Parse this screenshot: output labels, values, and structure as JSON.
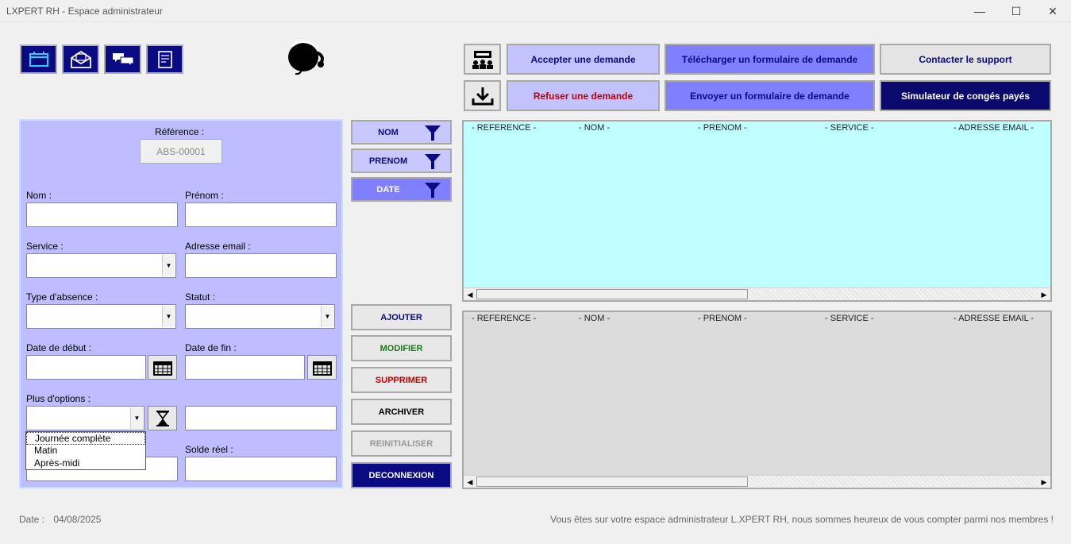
{
  "window": {
    "title": "LXPERT RH - Espace administrateur",
    "minimize": "—",
    "maximize": "☐",
    "close": "✕"
  },
  "top_icons": [
    "calendar-icon",
    "mail-icon",
    "chat-icon",
    "document-icon"
  ],
  "actions": {
    "accept": "Accepter une demande",
    "refuse": "Refuser une demande",
    "download_form": "Télécharger un formulaire de demande",
    "send_form": "Envoyer un formulaire de demande",
    "contact": "Contacter le support",
    "simulator": "Simulateur de congés payés"
  },
  "colors": {
    "accent_dark": "#0a0a82",
    "panel": "#bdbdff",
    "list_top": "#bfffff",
    "accept_red": "#c00000"
  },
  "form": {
    "reference_label": "Référence :",
    "reference_value": "ABS-00001",
    "nom_label": "Nom :",
    "prenom_label": "Prénom :",
    "service_label": "Service :",
    "email_label": "Adresse email :",
    "type_label": "Type d'absence :",
    "statut_label": "Statut :",
    "date_debut_label": "Date de début :",
    "date_fin_label": "Date de fin :",
    "options_label": "Plus d'options :",
    "solde_label": "Solde réel :",
    "options_popup": [
      "Journée complète",
      "Matin",
      "Après-midi"
    ]
  },
  "filters": {
    "nom": "NOM",
    "prenom": "PRENOM",
    "date": "DATE"
  },
  "operations": {
    "add": "AJOUTER",
    "modify": "MODIFIER",
    "delete": "SUPPRIMER",
    "archive": "ARCHIVER",
    "reset": "REINITIALISER",
    "logout": "DECONNEXION"
  },
  "list_columns": [
    "- REFERENCE -",
    "- NOM -",
    "- PRENOM -",
    "- SERVICE -",
    "- ADRESSE EMAIL -"
  ],
  "footer": {
    "date_label": "Date :",
    "date_value": "04/08/2025",
    "message": "Vous êtes sur votre espace administrateur L.XPERT RH, nous sommes heureux de vous compter parmi nos membres !"
  }
}
